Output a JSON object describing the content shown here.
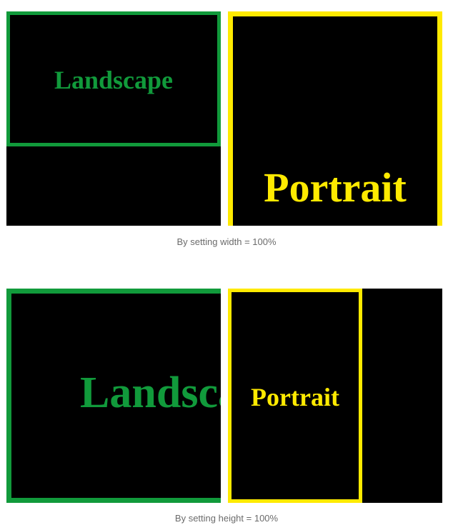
{
  "examples": [
    {
      "caption": "By setting width = 100%",
      "landscape_label": "Landscape",
      "portrait_label": "Portrait"
    },
    {
      "caption": "By setting height = 100%",
      "landscape_label": "Landscape",
      "portrait_label": "Portrait"
    }
  ],
  "colors": {
    "landscape": "#119a3b",
    "portrait": "#ffea00",
    "background": "#000000",
    "caption": "#6b6b6b"
  }
}
